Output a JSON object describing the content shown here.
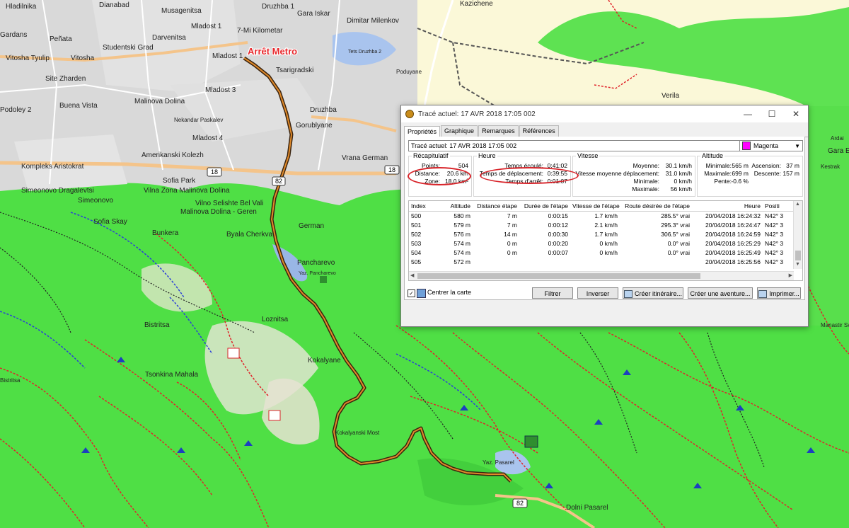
{
  "map": {
    "places": [
      "Hladilnika",
      "Dianabad",
      "Musagenitsa",
      "Druzhba 1",
      "Gara Iskar",
      "Kazichene",
      "Gardans",
      "Peñata",
      "Darvenitsa",
      "Mladost 1",
      "7-Mi Kilometar",
      "Dimitar Milenkov",
      "Vitosha Tyulip",
      "Studentski Grad",
      "Vitosha",
      "Mladost 1",
      "Tsarigradski",
      "Tets Druzhba 2",
      "Site Zharden",
      "Mladost 3",
      "Verila",
      "Buena Vista",
      "Malinova Dolina",
      "Druzhba",
      "Gorublyane",
      "Podoley 2",
      "Nekandar Paskalev",
      "Mladost 4",
      "Amerikanski Kolezh",
      "Vrana German",
      "Kompleks Aristokrat",
      "Gara E",
      "Simeonovo Dragalevtsi",
      "Sofia Park",
      "Vilna Zona Malinova Dolina",
      "Simeonovo",
      "Vilno Selishte Bel Vali",
      "Malinova Dolina - Geren",
      "Sofia Skay",
      "Bunkera",
      "Byala Cherkva",
      "German",
      "Pancharevo",
      "Loznitsa",
      "Bistritsa",
      "Tsonkina Mahala",
      "Kokalyane",
      "Kokalyanski Most",
      "Dolni Pasarel",
      "Yaz. Pasarel",
      "Manastir Sv",
      "Ardai",
      "Kestrak",
      "Yaz. Pancharevo",
      "Bistritsa",
      "Poduyane"
    ],
    "route_label": "Arrêt Metro",
    "road_shields": [
      "18",
      "18",
      "82",
      "82"
    ],
    "accent_route": "#8a4a1a",
    "forest_color": "#4fe04a",
    "urban_color": "#d7d7d7",
    "trail_color": "#e0242a"
  },
  "dialog": {
    "title": "Tracé actuel: 17 AVR 2018 17:05 002",
    "controls": {
      "minimize": "—",
      "maximize": "☐",
      "close": "✕"
    },
    "tabs": [
      "Propriétés",
      "Graphique",
      "Remarques",
      "Références"
    ],
    "name_value": "Tracé actuel: 17 AVR 2018 17:05 002",
    "color": {
      "label": "Magenta",
      "hex": "#ff00ff"
    },
    "summary": {
      "title": "Récapitulatif",
      "points_label": "Points:",
      "points": "504",
      "distance_label": "Distance:",
      "distance": "20.6 km",
      "zone_label": "Zone:",
      "zone": "18.0 km²"
    },
    "time": {
      "title": "Heure",
      "elapsed_label": "Temps écoulé:",
      "elapsed": "0:41:02",
      "moving_label": "Temps de déplacement:",
      "moving": "0:39:55",
      "stopped_label": "Temps d'arrêt:",
      "stopped": "0:01:07"
    },
    "speed": {
      "title": "Vitesse",
      "avg_label": "Moyenne:",
      "avg": "30.1 km/h",
      "avg_moving_label": "Vitesse moyenne déplacement:",
      "avg_moving": "31.0 km/h",
      "min_label": "Minimale:",
      "min": "0 km/h",
      "max_label": "Maximale:",
      "max": "56 km/h"
    },
    "altitude": {
      "title": "Altitude",
      "min_label": "Minimale:",
      "min": "565 m",
      "max_label": "Maximale:",
      "max": "699 m",
      "asc_label": "Ascension:",
      "asc": "37 m",
      "desc_label": "Descente:",
      "desc": "157 m",
      "slope_label": "Pente:",
      "slope": "-0.6 %"
    },
    "table": {
      "headers": [
        "Index",
        "Altitude",
        "Distance étape",
        "Durée de l'étape",
        "Vitesse de l'étape",
        "Route désirée de l'étape",
        "Heure",
        "Positi"
      ],
      "rows": [
        [
          "500",
          "580 m",
          "7 m",
          "0:00:15",
          "1.7 km/h",
          "285.5° vrai",
          "20/04/2018 16:24:32",
          "N42° 3"
        ],
        [
          "501",
          "579 m",
          "7 m",
          "0:00:12",
          "2.1 km/h",
          "295.3° vrai",
          "20/04/2018 16:24:47",
          "N42° 3"
        ],
        [
          "502",
          "576 m",
          "14 m",
          "0:00:30",
          "1.7 km/h",
          "306.5° vrai",
          "20/04/2018 16:24:59",
          "N42° 3"
        ],
        [
          "503",
          "574 m",
          "0 m",
          "0:00:20",
          "0 km/h",
          "0.0° vrai",
          "20/04/2018 16:25:29",
          "N42° 3"
        ],
        [
          "504",
          "574 m",
          "0 m",
          "0:00:07",
          "0 km/h",
          "0.0° vrai",
          "20/04/2018 16:25:49",
          "N42° 3"
        ],
        [
          "505",
          "572 m",
          "",
          "",
          "",
          "",
          "20/04/2018 16:25:56",
          "N42° 3"
        ]
      ]
    },
    "center_map": {
      "label": "Centrer la carte",
      "checked": "✓"
    },
    "buttons": {
      "filter": "Filtrer",
      "reverse": "Inverser",
      "route": "Créer itinéraire...",
      "adventure": "Créer une aventure...",
      "print": "Imprimer..."
    }
  }
}
